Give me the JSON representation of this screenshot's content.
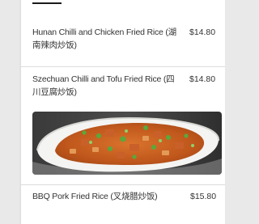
{
  "menu": {
    "items": [
      {
        "name": "Hunan Chilli and Chicken Fried Rice (湖南辣肉炒饭)",
        "price": "$14.80"
      },
      {
        "name": "Szechuan Chilli and Tofu Fried Rice (四川豆腐炒饭)",
        "price": "$14.80"
      },
      {
        "name": "BBQ Pork Fried Rice (叉烧腊炒饭)",
        "price": "$15.80"
      }
    ],
    "photo_icon": "food-photo"
  },
  "colors": {
    "card_bg": "#ffffff",
    "page_bg": "#e9e9e9",
    "text": "#333333",
    "divider": "#dcdcdc"
  }
}
